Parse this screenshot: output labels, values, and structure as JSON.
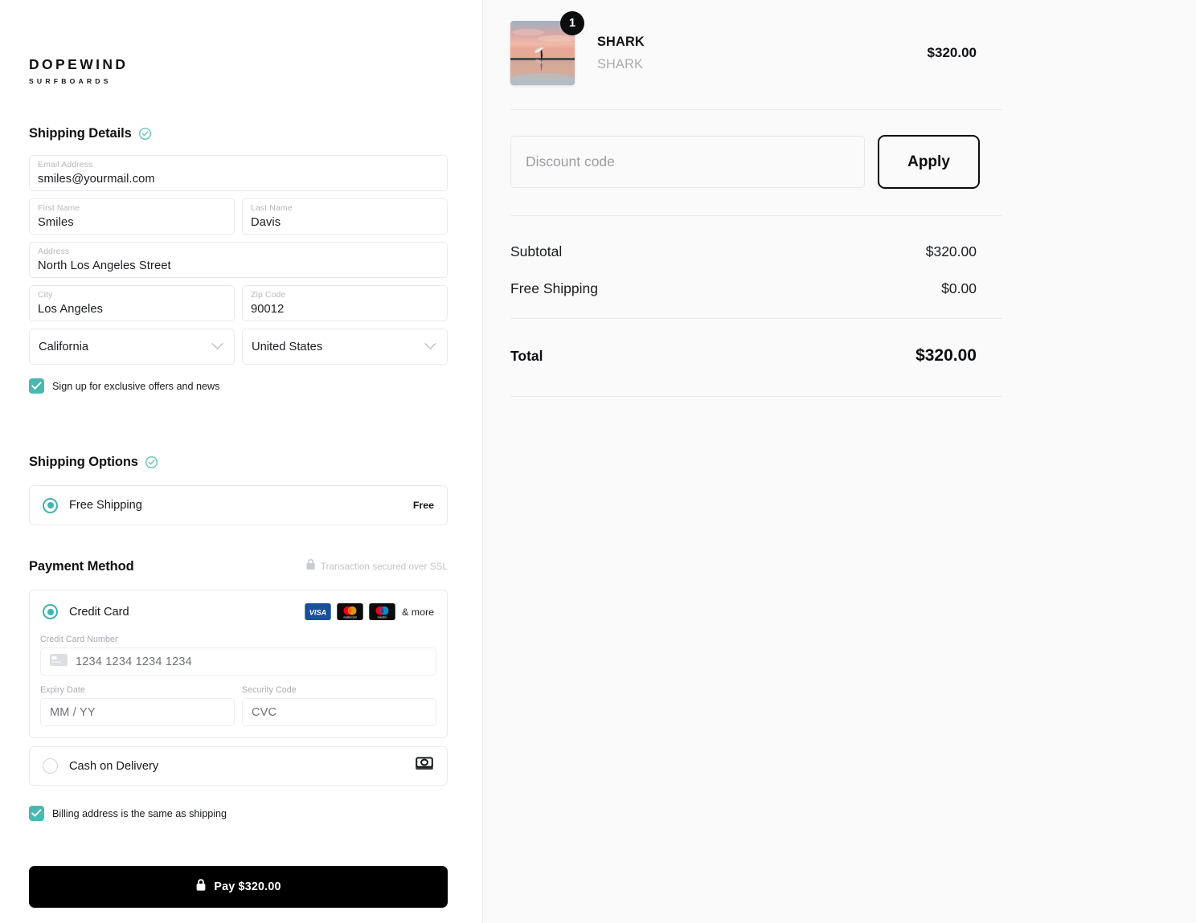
{
  "brand": {
    "name": "DOPEWIND",
    "subtitle": "SURFBOARDS"
  },
  "shipping_details": {
    "title": "Shipping Details",
    "complete_icon": "check-circle-icon",
    "fields": [
      {
        "label": "Email Address",
        "value": "smiles@yourmail.com"
      },
      {
        "label": "First Name",
        "value": "Smiles"
      },
      {
        "label": "Last Name",
        "value": "Davis"
      },
      {
        "label": "Address",
        "value": "North Los Angeles Street"
      },
      {
        "label": "City",
        "value": "Los Angeles"
      },
      {
        "label": "Zip Code",
        "value": "90012"
      }
    ],
    "state_select": {
      "value": "California",
      "icon": "chevron-down-icon"
    },
    "country_select": {
      "value": "United States",
      "icon": "chevron-down-icon"
    },
    "newsletter_checkbox": {
      "label": "Sign up for exclusive offers and news",
      "checked": true
    }
  },
  "shipping_options": {
    "title": "Shipping Options",
    "complete_icon": "check-circle-icon",
    "options": [
      {
        "label": "Free Shipping",
        "price": "Free",
        "selected": true
      }
    ]
  },
  "payment_method": {
    "title": "Payment Method",
    "ssl_notice": "Transaction secured over SSL",
    "ssl_icon": "lock-icon",
    "credit_card": {
      "label": "Credit Card",
      "selected": true,
      "brands": [
        "visa",
        "mastercard",
        "maestro"
      ],
      "more_label": "& more",
      "number_label": "Credit Card Number",
      "number_placeholder": "1234 1234 1234 1234",
      "number_icon": "credit-card-icon",
      "expiry_label": "Expiry Date",
      "expiry_placeholder": "MM / YY",
      "cvc_label": "Security Code",
      "cvc_placeholder": "CVC"
    },
    "cash_on_delivery": {
      "label": "Cash on Delivery",
      "selected": false,
      "icon": "cash-icon"
    },
    "billing_checkbox": {
      "label": "Billing address is the same as shipping",
      "checked": true
    }
  },
  "pay_button": {
    "label": "Pay $320.00",
    "icon": "lock-icon"
  },
  "order_summary": {
    "product": {
      "title": "SHARK",
      "variant": "SHARK",
      "price": "$320.00",
      "quantity": "1",
      "image_alt": "surfer-sunset-beach-photo"
    },
    "discount": {
      "placeholder": "Discount code",
      "apply_label": "Apply"
    },
    "lines": [
      {
        "label": "Subtotal",
        "value": "$320.00"
      },
      {
        "label": "Free Shipping",
        "value": "$0.00"
      }
    ],
    "total": {
      "label": "Total",
      "value": "$320.00"
    }
  },
  "colors": {
    "accent": "#4bb8b0",
    "dark": "#000000",
    "panel_bg": "#fafafa"
  }
}
